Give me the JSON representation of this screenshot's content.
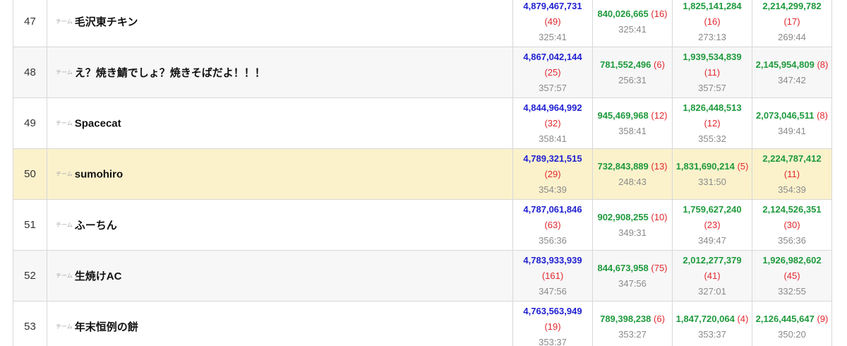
{
  "rows": [
    {
      "rank": "47",
      "team_prefix": "チーム",
      "team": "毛沢東チキン",
      "total": {
        "score": "4,879,467,731",
        "rank": "(49)",
        "time": "325:41"
      },
      "tasks": [
        {
          "score": "840,026,665",
          "rank": "(16)",
          "time": "325:41",
          "rank_wrap": false
        },
        {
          "score": "1,825,141,284",
          "rank": "(16)",
          "time": "273:13",
          "rank_wrap": true
        },
        {
          "score": "2,214,299,782",
          "rank": "(17)",
          "time": "269:44",
          "rank_wrap": true
        }
      ],
      "style": "plain"
    },
    {
      "rank": "48",
      "team_prefix": "チーム",
      "team": "え？焼き鯖でしょ？焼きそばだよ！！！",
      "total": {
        "score": "4,867,042,144",
        "rank": "(25)",
        "time": "357:57"
      },
      "tasks": [
        {
          "score": "781,552,496",
          "rank": "(6)",
          "time": "256:31",
          "rank_wrap": false
        },
        {
          "score": "1,939,534,839",
          "rank": "(11)",
          "time": "357:57",
          "rank_wrap": true
        },
        {
          "score": "2,145,954,809",
          "rank": "(8)",
          "time": "347:42",
          "rank_wrap": false
        }
      ],
      "style": "alt"
    },
    {
      "rank": "49",
      "team_prefix": "チーム",
      "team": "Spacecat",
      "total": {
        "score": "4,844,964,992",
        "rank": "(32)",
        "time": "358:41"
      },
      "tasks": [
        {
          "score": "945,469,968",
          "rank": "(12)",
          "time": "358:41",
          "rank_wrap": false
        },
        {
          "score": "1,826,448,513",
          "rank": "(12)",
          "time": "355:32",
          "rank_wrap": true
        },
        {
          "score": "2,073,046,511",
          "rank": "(8)",
          "time": "349:41",
          "rank_wrap": false
        }
      ],
      "style": "plain"
    },
    {
      "rank": "50",
      "team_prefix": "チーム",
      "team": "sumohiro",
      "total": {
        "score": "4,789,321,515",
        "rank": "(29)",
        "time": "354:39"
      },
      "tasks": [
        {
          "score": "732,843,889",
          "rank": "(13)",
          "time": "248:43",
          "rank_wrap": false
        },
        {
          "score": "1,831,690,214",
          "rank": "(5)",
          "time": "331:50",
          "rank_wrap": false
        },
        {
          "score": "2,224,787,412",
          "rank": "(11)",
          "time": "354:39",
          "rank_wrap": true
        }
      ],
      "style": "highlight"
    },
    {
      "rank": "51",
      "team_prefix": "チーム",
      "team": "ふーちん",
      "total": {
        "score": "4,787,061,846",
        "rank": "(63)",
        "time": "356:36"
      },
      "tasks": [
        {
          "score": "902,908,255",
          "rank": "(10)",
          "time": "349:31",
          "rank_wrap": false
        },
        {
          "score": "1,759,627,240",
          "rank": "(23)",
          "time": "349:47",
          "rank_wrap": true
        },
        {
          "score": "2,124,526,351",
          "rank": "(30)",
          "time": "356:36",
          "rank_wrap": true
        }
      ],
      "style": "plain"
    },
    {
      "rank": "52",
      "team_prefix": "チーム",
      "team": "生焼けAC",
      "total": {
        "score": "4,783,933,939",
        "rank": "(161)",
        "time": "347:56"
      },
      "tasks": [
        {
          "score": "844,673,958",
          "rank": "(75)",
          "time": "347:56",
          "rank_wrap": false
        },
        {
          "score": "2,012,277,379",
          "rank": "(41)",
          "time": "327:01",
          "rank_wrap": true
        },
        {
          "score": "1,926,982,602",
          "rank": "(45)",
          "time": "332:55",
          "rank_wrap": true
        }
      ],
      "style": "alt"
    },
    {
      "rank": "53",
      "team_prefix": "チーム",
      "team": "年末恒例の餅",
      "total": {
        "score": "4,763,563,949",
        "rank": "(19)",
        "time": "353:37"
      },
      "tasks": [
        {
          "score": "789,398,238",
          "rank": "(6)",
          "time": "353:27",
          "rank_wrap": false
        },
        {
          "score": "1,847,720,064",
          "rank": "(4)",
          "time": "353:37",
          "rank_wrap": false
        },
        {
          "score": "2,126,445,647",
          "rank": "(9)",
          "time": "350:20",
          "rank_wrap": false
        }
      ],
      "style": "plain"
    }
  ]
}
